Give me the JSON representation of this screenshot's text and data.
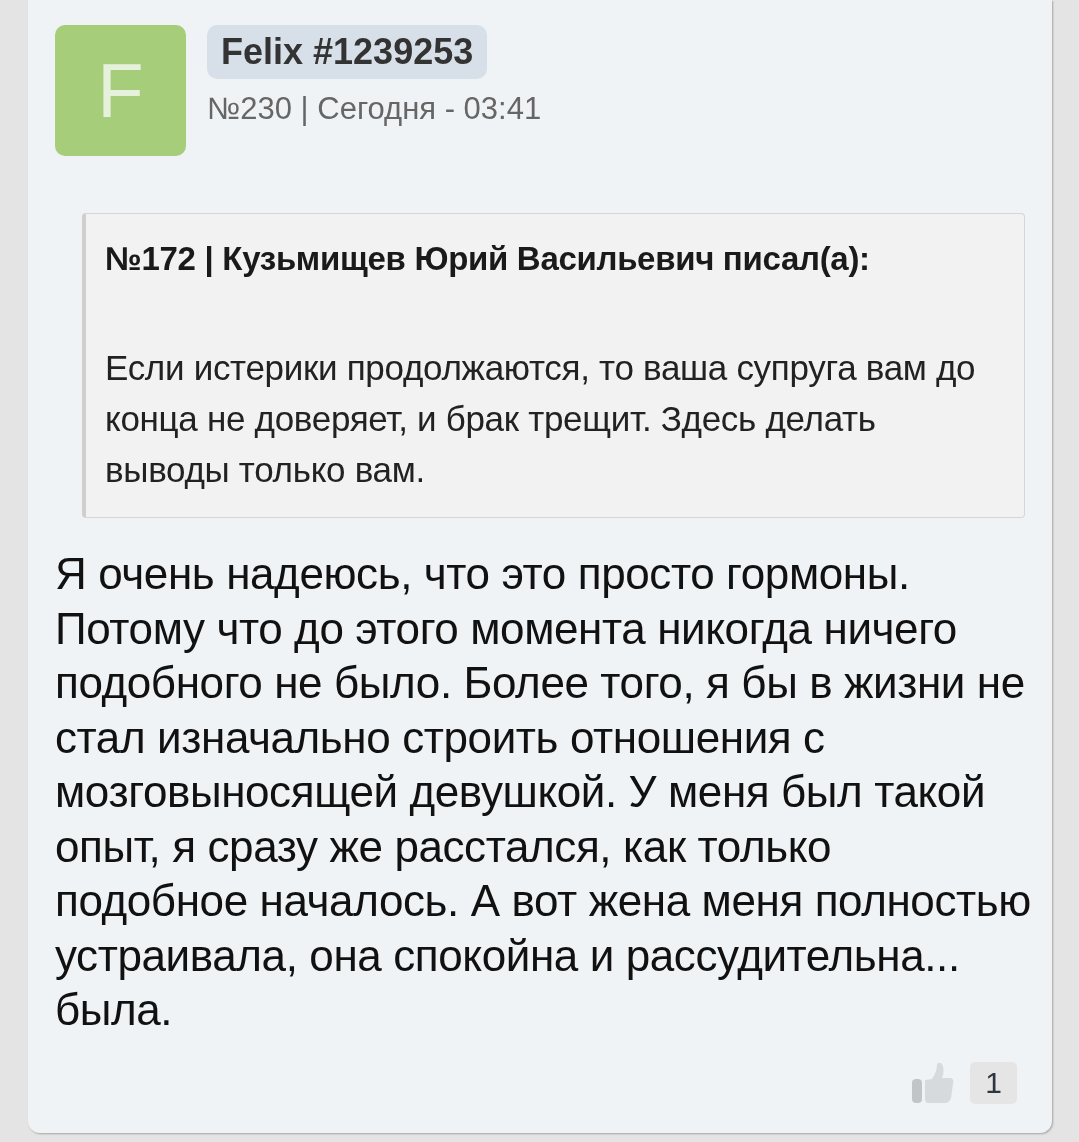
{
  "post": {
    "avatar": {
      "letter": "F"
    },
    "author": "Felix #1239253",
    "meta": "№230 | Сегодня - 03:41",
    "quote": {
      "title": "№172 | Кузьмищев Юрий Васильевич писал(а):",
      "text": "Если истерики продолжаются, то ваша супруга вам до конца не доверяет, и брак трещит. Здесь делать выводы только вам."
    },
    "text": "Я очень надеюсь, что это просто гормоны. Потому что до этого момента никогда ничего подобного не было. Более того, я бы в жизни не стал изначально строить отношения с мозговыносящей девушкой. У меня был такой опыт, я сразу же расстался, как только подобное началось. А вот жена меня полностью устраивала, она спокойна и рассудительна... была.",
    "likes": {
      "count": "1"
    }
  }
}
